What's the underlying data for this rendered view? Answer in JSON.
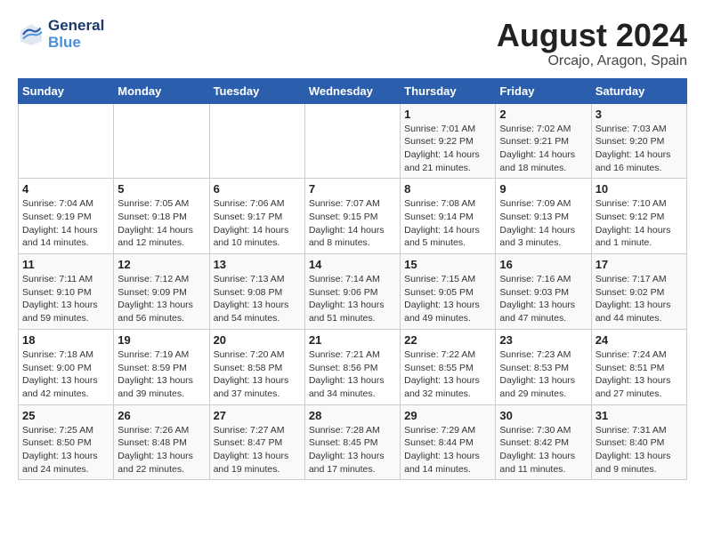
{
  "header": {
    "logo_line1": "General",
    "logo_line2": "Blue",
    "month_year": "August 2024",
    "location": "Orcajo, Aragon, Spain"
  },
  "days_of_week": [
    "Sunday",
    "Monday",
    "Tuesday",
    "Wednesday",
    "Thursday",
    "Friday",
    "Saturday"
  ],
  "weeks": [
    [
      {
        "day": "",
        "info": ""
      },
      {
        "day": "",
        "info": ""
      },
      {
        "day": "",
        "info": ""
      },
      {
        "day": "",
        "info": ""
      },
      {
        "day": "1",
        "info": "Sunrise: 7:01 AM\nSunset: 9:22 PM\nDaylight: 14 hours\nand 21 minutes."
      },
      {
        "day": "2",
        "info": "Sunrise: 7:02 AM\nSunset: 9:21 PM\nDaylight: 14 hours\nand 18 minutes."
      },
      {
        "day": "3",
        "info": "Sunrise: 7:03 AM\nSunset: 9:20 PM\nDaylight: 14 hours\nand 16 minutes."
      }
    ],
    [
      {
        "day": "4",
        "info": "Sunrise: 7:04 AM\nSunset: 9:19 PM\nDaylight: 14 hours\nand 14 minutes."
      },
      {
        "day": "5",
        "info": "Sunrise: 7:05 AM\nSunset: 9:18 PM\nDaylight: 14 hours\nand 12 minutes."
      },
      {
        "day": "6",
        "info": "Sunrise: 7:06 AM\nSunset: 9:17 PM\nDaylight: 14 hours\nand 10 minutes."
      },
      {
        "day": "7",
        "info": "Sunrise: 7:07 AM\nSunset: 9:15 PM\nDaylight: 14 hours\nand 8 minutes."
      },
      {
        "day": "8",
        "info": "Sunrise: 7:08 AM\nSunset: 9:14 PM\nDaylight: 14 hours\nand 5 minutes."
      },
      {
        "day": "9",
        "info": "Sunrise: 7:09 AM\nSunset: 9:13 PM\nDaylight: 14 hours\nand 3 minutes."
      },
      {
        "day": "10",
        "info": "Sunrise: 7:10 AM\nSunset: 9:12 PM\nDaylight: 14 hours\nand 1 minute."
      }
    ],
    [
      {
        "day": "11",
        "info": "Sunrise: 7:11 AM\nSunset: 9:10 PM\nDaylight: 13 hours\nand 59 minutes."
      },
      {
        "day": "12",
        "info": "Sunrise: 7:12 AM\nSunset: 9:09 PM\nDaylight: 13 hours\nand 56 minutes."
      },
      {
        "day": "13",
        "info": "Sunrise: 7:13 AM\nSunset: 9:08 PM\nDaylight: 13 hours\nand 54 minutes."
      },
      {
        "day": "14",
        "info": "Sunrise: 7:14 AM\nSunset: 9:06 PM\nDaylight: 13 hours\nand 51 minutes."
      },
      {
        "day": "15",
        "info": "Sunrise: 7:15 AM\nSunset: 9:05 PM\nDaylight: 13 hours\nand 49 minutes."
      },
      {
        "day": "16",
        "info": "Sunrise: 7:16 AM\nSunset: 9:03 PM\nDaylight: 13 hours\nand 47 minutes."
      },
      {
        "day": "17",
        "info": "Sunrise: 7:17 AM\nSunset: 9:02 PM\nDaylight: 13 hours\nand 44 minutes."
      }
    ],
    [
      {
        "day": "18",
        "info": "Sunrise: 7:18 AM\nSunset: 9:00 PM\nDaylight: 13 hours\nand 42 minutes."
      },
      {
        "day": "19",
        "info": "Sunrise: 7:19 AM\nSunset: 8:59 PM\nDaylight: 13 hours\nand 39 minutes."
      },
      {
        "day": "20",
        "info": "Sunrise: 7:20 AM\nSunset: 8:58 PM\nDaylight: 13 hours\nand 37 minutes."
      },
      {
        "day": "21",
        "info": "Sunrise: 7:21 AM\nSunset: 8:56 PM\nDaylight: 13 hours\nand 34 minutes."
      },
      {
        "day": "22",
        "info": "Sunrise: 7:22 AM\nSunset: 8:55 PM\nDaylight: 13 hours\nand 32 minutes."
      },
      {
        "day": "23",
        "info": "Sunrise: 7:23 AM\nSunset: 8:53 PM\nDaylight: 13 hours\nand 29 minutes."
      },
      {
        "day": "24",
        "info": "Sunrise: 7:24 AM\nSunset: 8:51 PM\nDaylight: 13 hours\nand 27 minutes."
      }
    ],
    [
      {
        "day": "25",
        "info": "Sunrise: 7:25 AM\nSunset: 8:50 PM\nDaylight: 13 hours\nand 24 minutes."
      },
      {
        "day": "26",
        "info": "Sunrise: 7:26 AM\nSunset: 8:48 PM\nDaylight: 13 hours\nand 22 minutes."
      },
      {
        "day": "27",
        "info": "Sunrise: 7:27 AM\nSunset: 8:47 PM\nDaylight: 13 hours\nand 19 minutes."
      },
      {
        "day": "28",
        "info": "Sunrise: 7:28 AM\nSunset: 8:45 PM\nDaylight: 13 hours\nand 17 minutes."
      },
      {
        "day": "29",
        "info": "Sunrise: 7:29 AM\nSunset: 8:44 PM\nDaylight: 13 hours\nand 14 minutes."
      },
      {
        "day": "30",
        "info": "Sunrise: 7:30 AM\nSunset: 8:42 PM\nDaylight: 13 hours\nand 11 minutes."
      },
      {
        "day": "31",
        "info": "Sunrise: 7:31 AM\nSunset: 8:40 PM\nDaylight: 13 hours\nand 9 minutes."
      }
    ]
  ]
}
